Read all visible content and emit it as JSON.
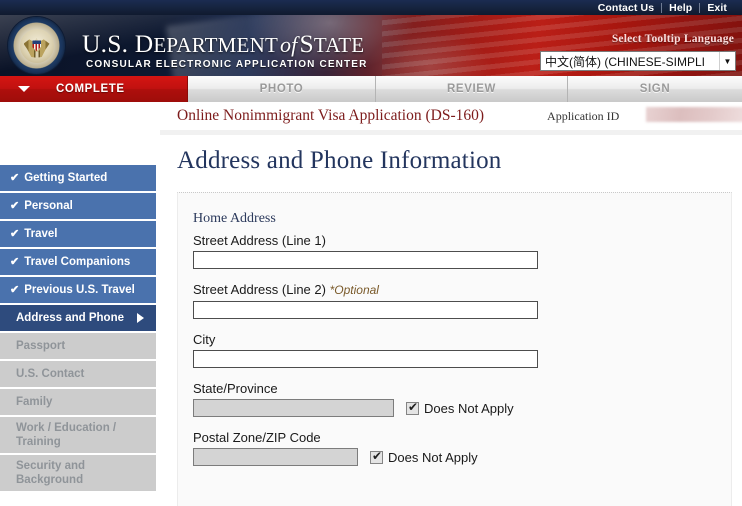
{
  "utility_nav": [
    {
      "label": "Contact Us",
      "name": "contact-us-link"
    },
    {
      "label": "Help",
      "name": "help-link"
    },
    {
      "label": "Exit",
      "name": "exit-link"
    }
  ],
  "header": {
    "org_us": "U.S. ",
    "org_department": "D",
    "org_department_rest": "EPARTMENT",
    "org_of": "of",
    "org_state": "S",
    "org_state_rest": "TATE",
    "subtitle": "CONSULAR ELECTRONIC APPLICATION CENTER",
    "seal_alt": "great-seal-of-the-united-states",
    "language_label": "Select Tooltip Language",
    "language_value": "中文(简体)  (CHINESE-SIMPLI",
    "language_caret": "▼"
  },
  "tabs": [
    {
      "label": "COMPLETE",
      "state": "active"
    },
    {
      "label": "PHOTO",
      "state": "inactive"
    },
    {
      "label": "REVIEW",
      "state": "inactive"
    },
    {
      "label": "SIGN",
      "state": "inactive"
    }
  ],
  "application": {
    "title": "Online Nonimmigrant Visa Application (DS-160)",
    "app_id_label": "Application ID",
    "app_id_value": ""
  },
  "page_heading": "Address and Phone Information",
  "sidebar": {
    "items": [
      {
        "label": "Getting Started",
        "state": "done",
        "check": "✔"
      },
      {
        "label": "Personal",
        "state": "done",
        "check": "✔"
      },
      {
        "label": "Travel",
        "state": "done",
        "check": "✔"
      },
      {
        "label": "Travel Companions",
        "state": "done",
        "check": "✔"
      },
      {
        "label": "Previous U.S. Travel",
        "state": "done",
        "check": "✔"
      },
      {
        "label": "Address and Phone",
        "state": "current",
        "check": ""
      },
      {
        "label": "Passport",
        "state": "pending",
        "check": ""
      },
      {
        "label": "U.S. Contact",
        "state": "pending",
        "check": ""
      },
      {
        "label": "Family",
        "state": "pending",
        "check": ""
      },
      {
        "label": "Work / Education / Training",
        "state": "pending",
        "check": ""
      },
      {
        "label": "Security and Background",
        "state": "pending",
        "check": ""
      }
    ]
  },
  "form": {
    "group_heading": "Home Address",
    "fields": {
      "street1": {
        "label": "Street Address (Line 1)",
        "value": "",
        "placeholder": ""
      },
      "street2": {
        "label": "Street Address (Line 2)",
        "optional": "*Optional",
        "value": "",
        "placeholder": ""
      },
      "city": {
        "label": "City",
        "value": "",
        "placeholder": ""
      },
      "state": {
        "label": "State/Province",
        "value": "",
        "placeholder": "",
        "disabled": true,
        "does_not_apply_label": "Does Not Apply",
        "does_not_apply_checked": true
      },
      "postal": {
        "label": "Postal Zone/ZIP Code",
        "value": "",
        "placeholder": "",
        "disabled": true,
        "does_not_apply_label": "Does Not Apply",
        "does_not_apply_checked": true
      }
    }
  },
  "colors": {
    "brand_navy": "#23355e",
    "brand_red": "#7d1c1c",
    "tab_active": "#c11110",
    "nav_done": "#4a72ad",
    "nav_current": "#2e4b7d",
    "nav_pending": "#cccccc"
  }
}
